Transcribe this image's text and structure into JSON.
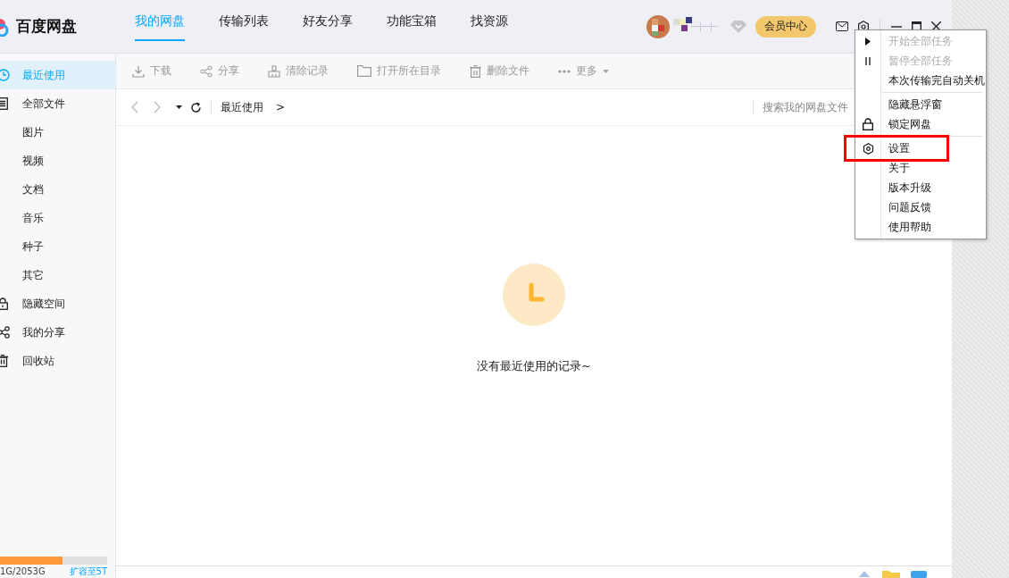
{
  "app": {
    "title": "百度网盘"
  },
  "tabs": [
    {
      "label": "我的网盘",
      "selected": true
    },
    {
      "label": "传输列表",
      "selected": false
    },
    {
      "label": "好友分享",
      "selected": false
    },
    {
      "label": "功能宝箱",
      "selected": false
    },
    {
      "label": "找资源",
      "selected": false
    }
  ],
  "header": {
    "vip_button": "会员中心"
  },
  "sidebar": {
    "items": [
      {
        "label": "最近使用",
        "selected": true
      },
      {
        "label": "全部文件",
        "selected": false,
        "children": [
          {
            "label": "图片",
            "selected": false
          },
          {
            "label": "视频",
            "selected": false
          },
          {
            "label": "文档",
            "selected": false
          },
          {
            "label": "音乐",
            "selected": false
          },
          {
            "label": "种子",
            "selected": false
          },
          {
            "label": "其它",
            "selected": false
          }
        ]
      },
      {
        "label": "隐藏空间",
        "selected": false
      },
      {
        "label": "我的分享",
        "selected": false
      },
      {
        "label": "回收站",
        "selected": false
      }
    ],
    "storage": {
      "level": 0.58,
      "usage": "1G/2053G",
      "upgrade_link": "扩容至5T"
    }
  },
  "toolbar": [
    {
      "label": "下载",
      "disabled": true
    },
    {
      "label": "分享",
      "disabled": true
    },
    {
      "label": "清除记录",
      "disabled": true
    },
    {
      "label": "打开所在目录",
      "disabled": true
    },
    {
      "label": "删除文件",
      "disabled": true
    },
    {
      "label": "更多",
      "disabled": true
    }
  ],
  "breadcrumb": {
    "path": "最近使用",
    "separator": ">"
  },
  "search": {
    "placeholder": "搜索我的网盘文件"
  },
  "empty_state": {
    "message": "没有最近使用的记录~"
  },
  "menu": {
    "sections": [
      [
        {
          "label": "开始全部任务",
          "disabled": true,
          "highlighted": false
        },
        {
          "label": "暂停全部任务",
          "disabled": true,
          "highlighted": false
        },
        {
          "label": "本次传输完自动关机",
          "disabled": false,
          "highlighted": false
        }
      ],
      [
        {
          "label": "隐藏悬浮窗",
          "disabled": false,
          "highlighted": false
        },
        {
          "label": "锁定网盘",
          "disabled": false,
          "highlighted": false
        }
      ],
      [
        {
          "label": "设置",
          "disabled": false,
          "highlighted": true
        },
        {
          "label": "关于",
          "disabled": false,
          "highlighted": false
        },
        {
          "label": "版本升级",
          "disabled": false,
          "highlighted": false
        },
        {
          "label": "问题反馈",
          "disabled": false,
          "highlighted": false
        },
        {
          "label": "使用帮助",
          "disabled": false,
          "highlighted": false
        }
      ]
    ]
  }
}
